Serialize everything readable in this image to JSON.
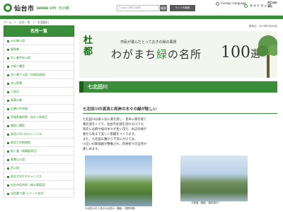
{
  "header": {
    "logo_text": "仙台市",
    "logo_sub": "SENDAI CITY",
    "logo_sub2": "杜の都",
    "search_placeholder": "Google 提供の検索",
    "search_button": "検索",
    "site_search_button": "サイト内検索",
    "language": "Foreign Language",
    "sitemap": "サイトマップ",
    "reading": "閲覧補助",
    "reading2": "機能"
  },
  "breadcrumb": {
    "home": "ホーム",
    "parent": "名所一覧",
    "current": "七北田川"
  },
  "updated": "更新日：2018年9月28日",
  "sidebar": {
    "title": "名所一覧",
    "items": [
      {
        "label": "水の森公園"
      },
      {
        "label": "権現森"
      },
      {
        "label": "貝ヶ森中央公園"
      },
      {
        "label": "大崎八幡宮"
      },
      {
        "label": "北六番丁公園（内務局庭園）"
      },
      {
        "label": "北山界隈"
      },
      {
        "label": "三居沢"
      },
      {
        "label": "青葉の森"
      },
      {
        "label": "広瀬川中流域"
      },
      {
        "label": "宮城県美術館・仙台二高周辺"
      },
      {
        "label": "亀岡八幡宮"
      },
      {
        "label": "東北大学川内キャンパス"
      },
      {
        "label": "東北大学植物園"
      },
      {
        "label": "経ヶ峯（瑞鳳殿周辺）"
      },
      {
        "label": "青葉山公園"
      },
      {
        "label": "西公園"
      },
      {
        "label": "東北大学片平キャンパス"
      },
      {
        "label": "仙台市役所前（緑水庵庭園）"
      },
      {
        "label": "北四番丁通“ユリノキ並木”"
      }
    ]
  },
  "banner": {
    "small": "市民が選んだとっておきの緑の風景",
    "main_prefix": "わがまち",
    "main_green": "緑",
    "main_suffix": "の名所",
    "number": "100",
    "number_suffix": "選",
    "calligraphy1": "杜",
    "calligraphy2": "都"
  },
  "title": "七北田川",
  "subhead": "七北田川の清流と両岸の木々の緑が眩しい",
  "body": [
    "七北田川は泉ヶ岳に源を発し、長命ヶ森を経て",
    "東北道をくぐり、仙台市北部を流れる川です。",
    "両岸には柳や桜の木々が生い茂り、水辺の緑が",
    "春から秋まで美しい景観をつくります。",
    "また、七北田公園から下流にかけては、",
    "川沿いの散策路が整備され、四季折々の自然が",
    "楽しめます。"
  ],
  "photos": {
    "caption1": "七北田川の上流の七北田川（撮影：浅野利雄）",
    "caption2": "今宮堰（撮影：森田俊行）"
  }
}
